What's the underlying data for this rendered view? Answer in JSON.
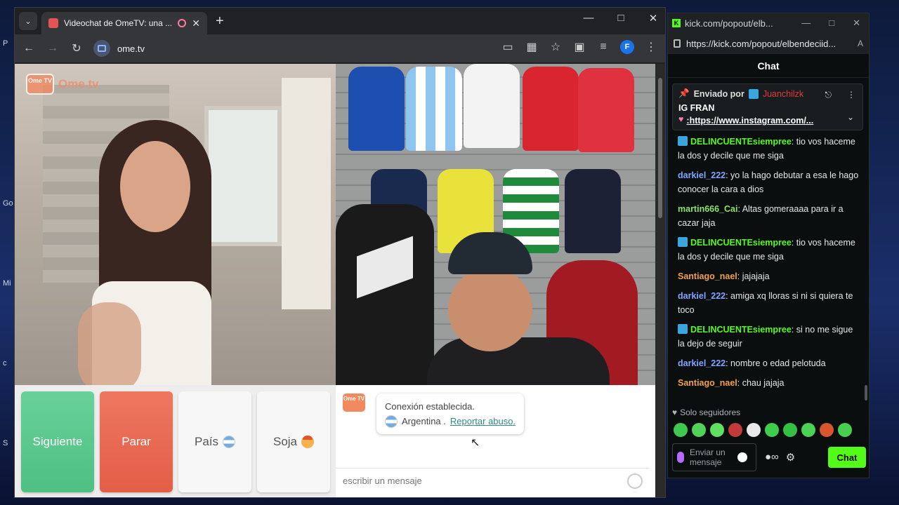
{
  "desktop": {
    "fragments": [
      "P",
      "Go",
      "Mi",
      "c",
      "S"
    ]
  },
  "browser": {
    "tab_title": "Videochat de OmeTV: una ...",
    "url": "ome.tv",
    "profile_letter": "F",
    "logo_tv": "Ome TV",
    "logo_text": "Ome.tv"
  },
  "controls": {
    "next": "Siguiente",
    "stop": "Parar",
    "country": "País",
    "gender": "Soja"
  },
  "chat": {
    "logo": "Ome TV",
    "connected": "Conexión establecida.",
    "country": "Argentina .",
    "report": "Reportar abuso.",
    "input_placeholder": "escribir un mensaje"
  },
  "kick": {
    "window_title": "kick.com/popout/elb...",
    "url": "https://kick.com/popout/elbendeciid...",
    "header": "Chat",
    "pinned": {
      "sent_by": "Enviado por",
      "user": "Juanchilzk",
      "name": "IG FRAN",
      "link": ":https://www.instagram.com/..."
    },
    "messages": [
      {
        "user": "DELINCUENTEsiempree",
        "text": ": tio vos haceme la dos y decile que me siga",
        "color": "green",
        "badge": true
      },
      {
        "user": "darkiel_222",
        "text": ": yo la hago debutar a esa le hago conocer la cara a dios",
        "color": "blue",
        "badge": false
      },
      {
        "user": "martin666_Cai",
        "text": ": Altas gomeraaaa para ir a cazar jaja",
        "color": "lgreen",
        "badge": false
      },
      {
        "user": "DELINCUENTEsiempree",
        "text": ": tio vos haceme la dos y decile que me siga",
        "color": "green",
        "badge": true
      },
      {
        "user": "Santiago_nael",
        "text": ": jajajaja",
        "color": "orange",
        "badge": false
      },
      {
        "user": "darkiel_222",
        "text": ": amiga xq lloras si ni si quiera te toco",
        "color": "blue",
        "badge": false
      },
      {
        "user": "DELINCUENTEsiempree",
        "text": ": si no me sigue la dejo de seguir",
        "color": "green",
        "badge": true
      },
      {
        "user": "darkiel_222",
        "text": ": nombre o edad pelotuda",
        "color": "blue",
        "badge": false
      },
      {
        "user": "Santiago_nael",
        "text": ": chau jajaja",
        "color": "orange",
        "badge": false
      }
    ],
    "followers_only": "Solo seguidores",
    "compose_placeholder": "Enviar un mensaje",
    "send_button": "Chat"
  }
}
